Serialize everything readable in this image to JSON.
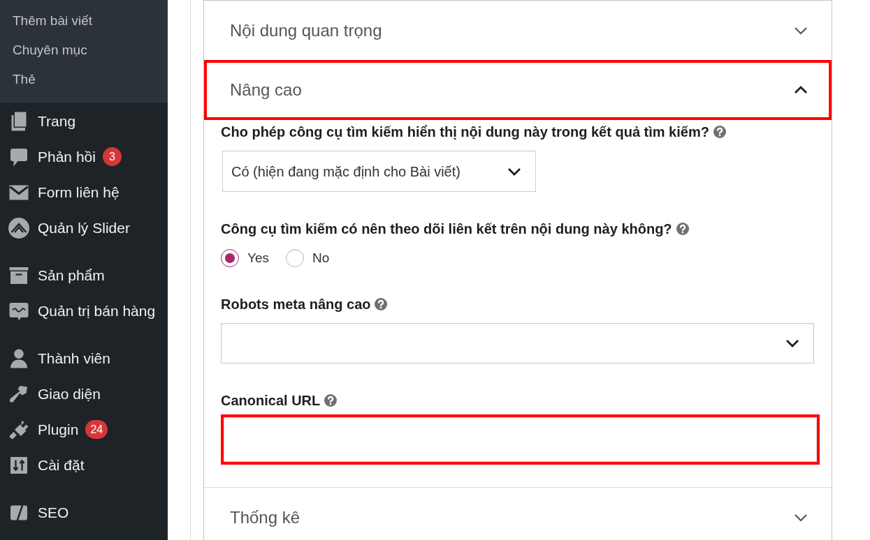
{
  "sidebar": {
    "submenu": [
      {
        "label": "Thêm bài viết",
        "selected": false
      },
      {
        "label": "Chuyên mục",
        "selected": false
      },
      {
        "label": "Thẻ",
        "selected": false
      }
    ],
    "groups": [
      {
        "items": [
          {
            "label": "Trang",
            "selected": false
          },
          {
            "label": "Phản hồi",
            "badge": "3",
            "selected": false
          },
          {
            "label": "Form liên hệ",
            "selected": false
          },
          {
            "label": "Quản lý Slider",
            "selected": false
          }
        ]
      },
      {
        "items": [
          {
            "label": "Sản phẩm",
            "selected": false
          },
          {
            "label": "Quản trị bán hàng",
            "selected": false
          }
        ]
      },
      {
        "items": [
          {
            "label": "Thành viên",
            "selected": false
          },
          {
            "label": "Giao diện",
            "selected": false
          },
          {
            "label": "Plugin",
            "badge": "24",
            "selected": false
          },
          {
            "label": "Cài đặt",
            "selected": false
          }
        ]
      },
      {
        "items": [
          {
            "label": "SEO",
            "selected": false
          }
        ]
      }
    ]
  },
  "metabox": {
    "sections": [
      {
        "title": "Nội dung quan trọng",
        "expanded": false,
        "highlighted": false
      },
      {
        "title": "Nâng cao",
        "expanded": true,
        "highlighted": true,
        "fields": [
          {
            "kind": "select",
            "label": "Cho phép công cụ tìm kiếm hiển thị nội dung này trong kết quả tìm kiếm?",
            "help": true,
            "value": "Có (hiện đang mặc định cho Bài viết)"
          },
          {
            "kind": "radio",
            "label": "Công cụ tìm kiếm có nên theo dõi liên kết trên nội dung này không?",
            "help": true,
            "options": [
              {
                "label": "Yes",
                "selected": true
              },
              {
                "label": "No",
                "selected": false
              }
            ]
          },
          {
            "kind": "select",
            "label": "Robots meta nâng cao",
            "help": true
          },
          {
            "kind": "text",
            "label": "Canonical URL",
            "help": true,
            "highlighted": true
          }
        ]
      },
      {
        "title": "Thống kê",
        "expanded": false,
        "highlighted": false
      }
    ]
  }
}
